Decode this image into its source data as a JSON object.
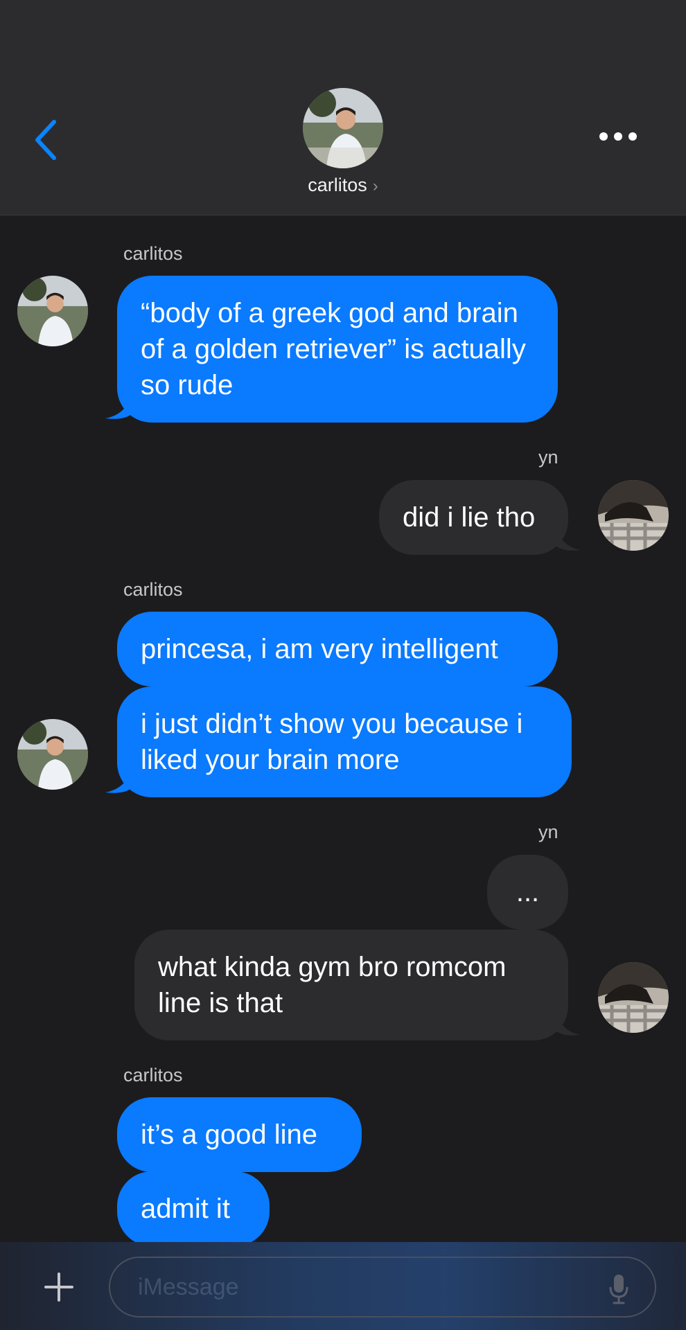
{
  "header": {
    "contact_name": "carlitos",
    "chevron": "›"
  },
  "icons": {
    "back": "chevron-left-icon",
    "more": "ellipsis-icon",
    "plus": "plus-icon",
    "mic": "microphone-icon"
  },
  "colors": {
    "accent": "#0a7aff",
    "incoming_bubble": "#0a7aff",
    "outgoing_bubble": "#2c2c2e",
    "background": "#1c1c1e"
  },
  "messages": [
    {
      "sender": "carlitos",
      "text": "“body of a greek god and brain of a golden retriever” is actually so rude"
    },
    {
      "sender": "yn",
      "text": "did i lie tho"
    },
    {
      "sender": "carlitos",
      "text": "princesa, i am very intelligent"
    },
    {
      "sender": "carlitos",
      "text": "i just didn’t show you because i liked your brain more"
    },
    {
      "sender": "yn",
      "text": "..."
    },
    {
      "sender": "yn",
      "text": "what kinda gym bro romcom line is that"
    },
    {
      "sender": "carlitos",
      "text": "it’s a good line"
    },
    {
      "sender": "carlitos",
      "text": "admit it"
    }
  ],
  "composer": {
    "placeholder": "iMessage"
  }
}
